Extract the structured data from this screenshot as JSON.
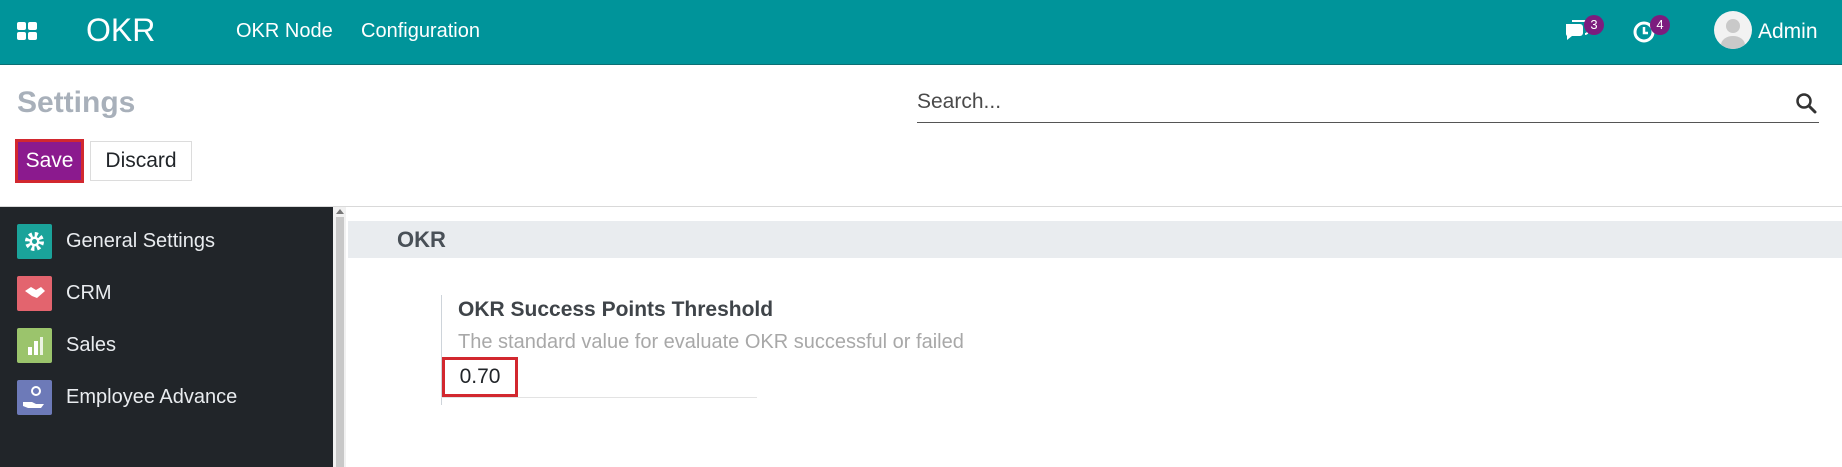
{
  "topbar": {
    "brand": "OKR",
    "menu": [
      "OKR Node",
      "Configuration"
    ],
    "messages_count": "3",
    "activities_count": "4",
    "user_name": "Admin",
    "bg_color": "#00949a"
  },
  "header": {
    "title": "Settings",
    "save_label": "Save",
    "discard_label": "Discard"
  },
  "search": {
    "placeholder": "Search..."
  },
  "sidebar": {
    "items": [
      {
        "label": "General Settings",
        "icon": "gear-icon",
        "color": "#1aa39a"
      },
      {
        "label": "CRM",
        "icon": "handshake-icon",
        "color": "#e3646e"
      },
      {
        "label": "Sales",
        "icon": "sales-chart-icon",
        "color": "#9bc46c"
      },
      {
        "label": "Employee Advance",
        "icon": "hand-coin-icon",
        "color": "#6d7ab8"
      }
    ]
  },
  "main": {
    "section_title": "OKR",
    "setting": {
      "title": "OKR Success Points Threshold",
      "description": "The standard value for evaluate OKR successful or failed",
      "value": "0.70"
    }
  }
}
